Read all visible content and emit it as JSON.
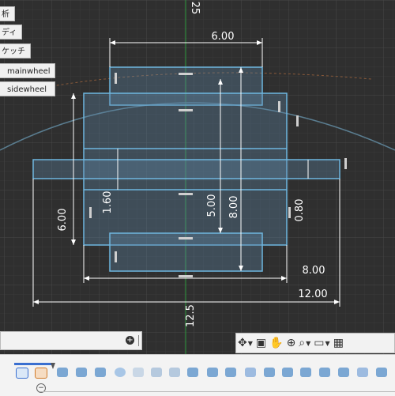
{
  "browser": {
    "items": [
      {
        "label": "析"
      },
      {
        "label": "ディ"
      },
      {
        "label": "ケッチ"
      },
      {
        "label": "mainwheel"
      },
      {
        "label": "sidewheel"
      }
    ]
  },
  "sketch": {
    "dimensions": {
      "top_width": "6.00",
      "axis_top": "25",
      "axis_bottom": "12.5",
      "left_height": "6.00",
      "inner_a": "1.60",
      "inner_b": "5.00",
      "inner_c": "8.00",
      "right_small": "0.80",
      "right_width": "8.00",
      "total_width": "12.00"
    }
  },
  "palette": {
    "toggle_icon": "plus-circle-icon"
  },
  "navbar": {
    "tools": [
      "orbit-icon",
      "look-at-icon",
      "pan-hand-icon",
      "zoom-icon",
      "fit-icon",
      "display-settings-icon",
      "grid-icon"
    ]
  },
  "timeline": {
    "features": [
      "sketch",
      "extrude",
      "extrude",
      "extrude",
      "pattern",
      "combine",
      "move",
      "move",
      "body",
      "body",
      "body",
      "body",
      "body",
      "body",
      "body",
      "body",
      "sketch",
      "sketch",
      "body",
      "body",
      "body",
      "body"
    ]
  },
  "colors": {
    "sketch_line": "#6fb7e0",
    "grid_bg": "#2f2f2f",
    "axis_green": "#2e9a3e"
  }
}
